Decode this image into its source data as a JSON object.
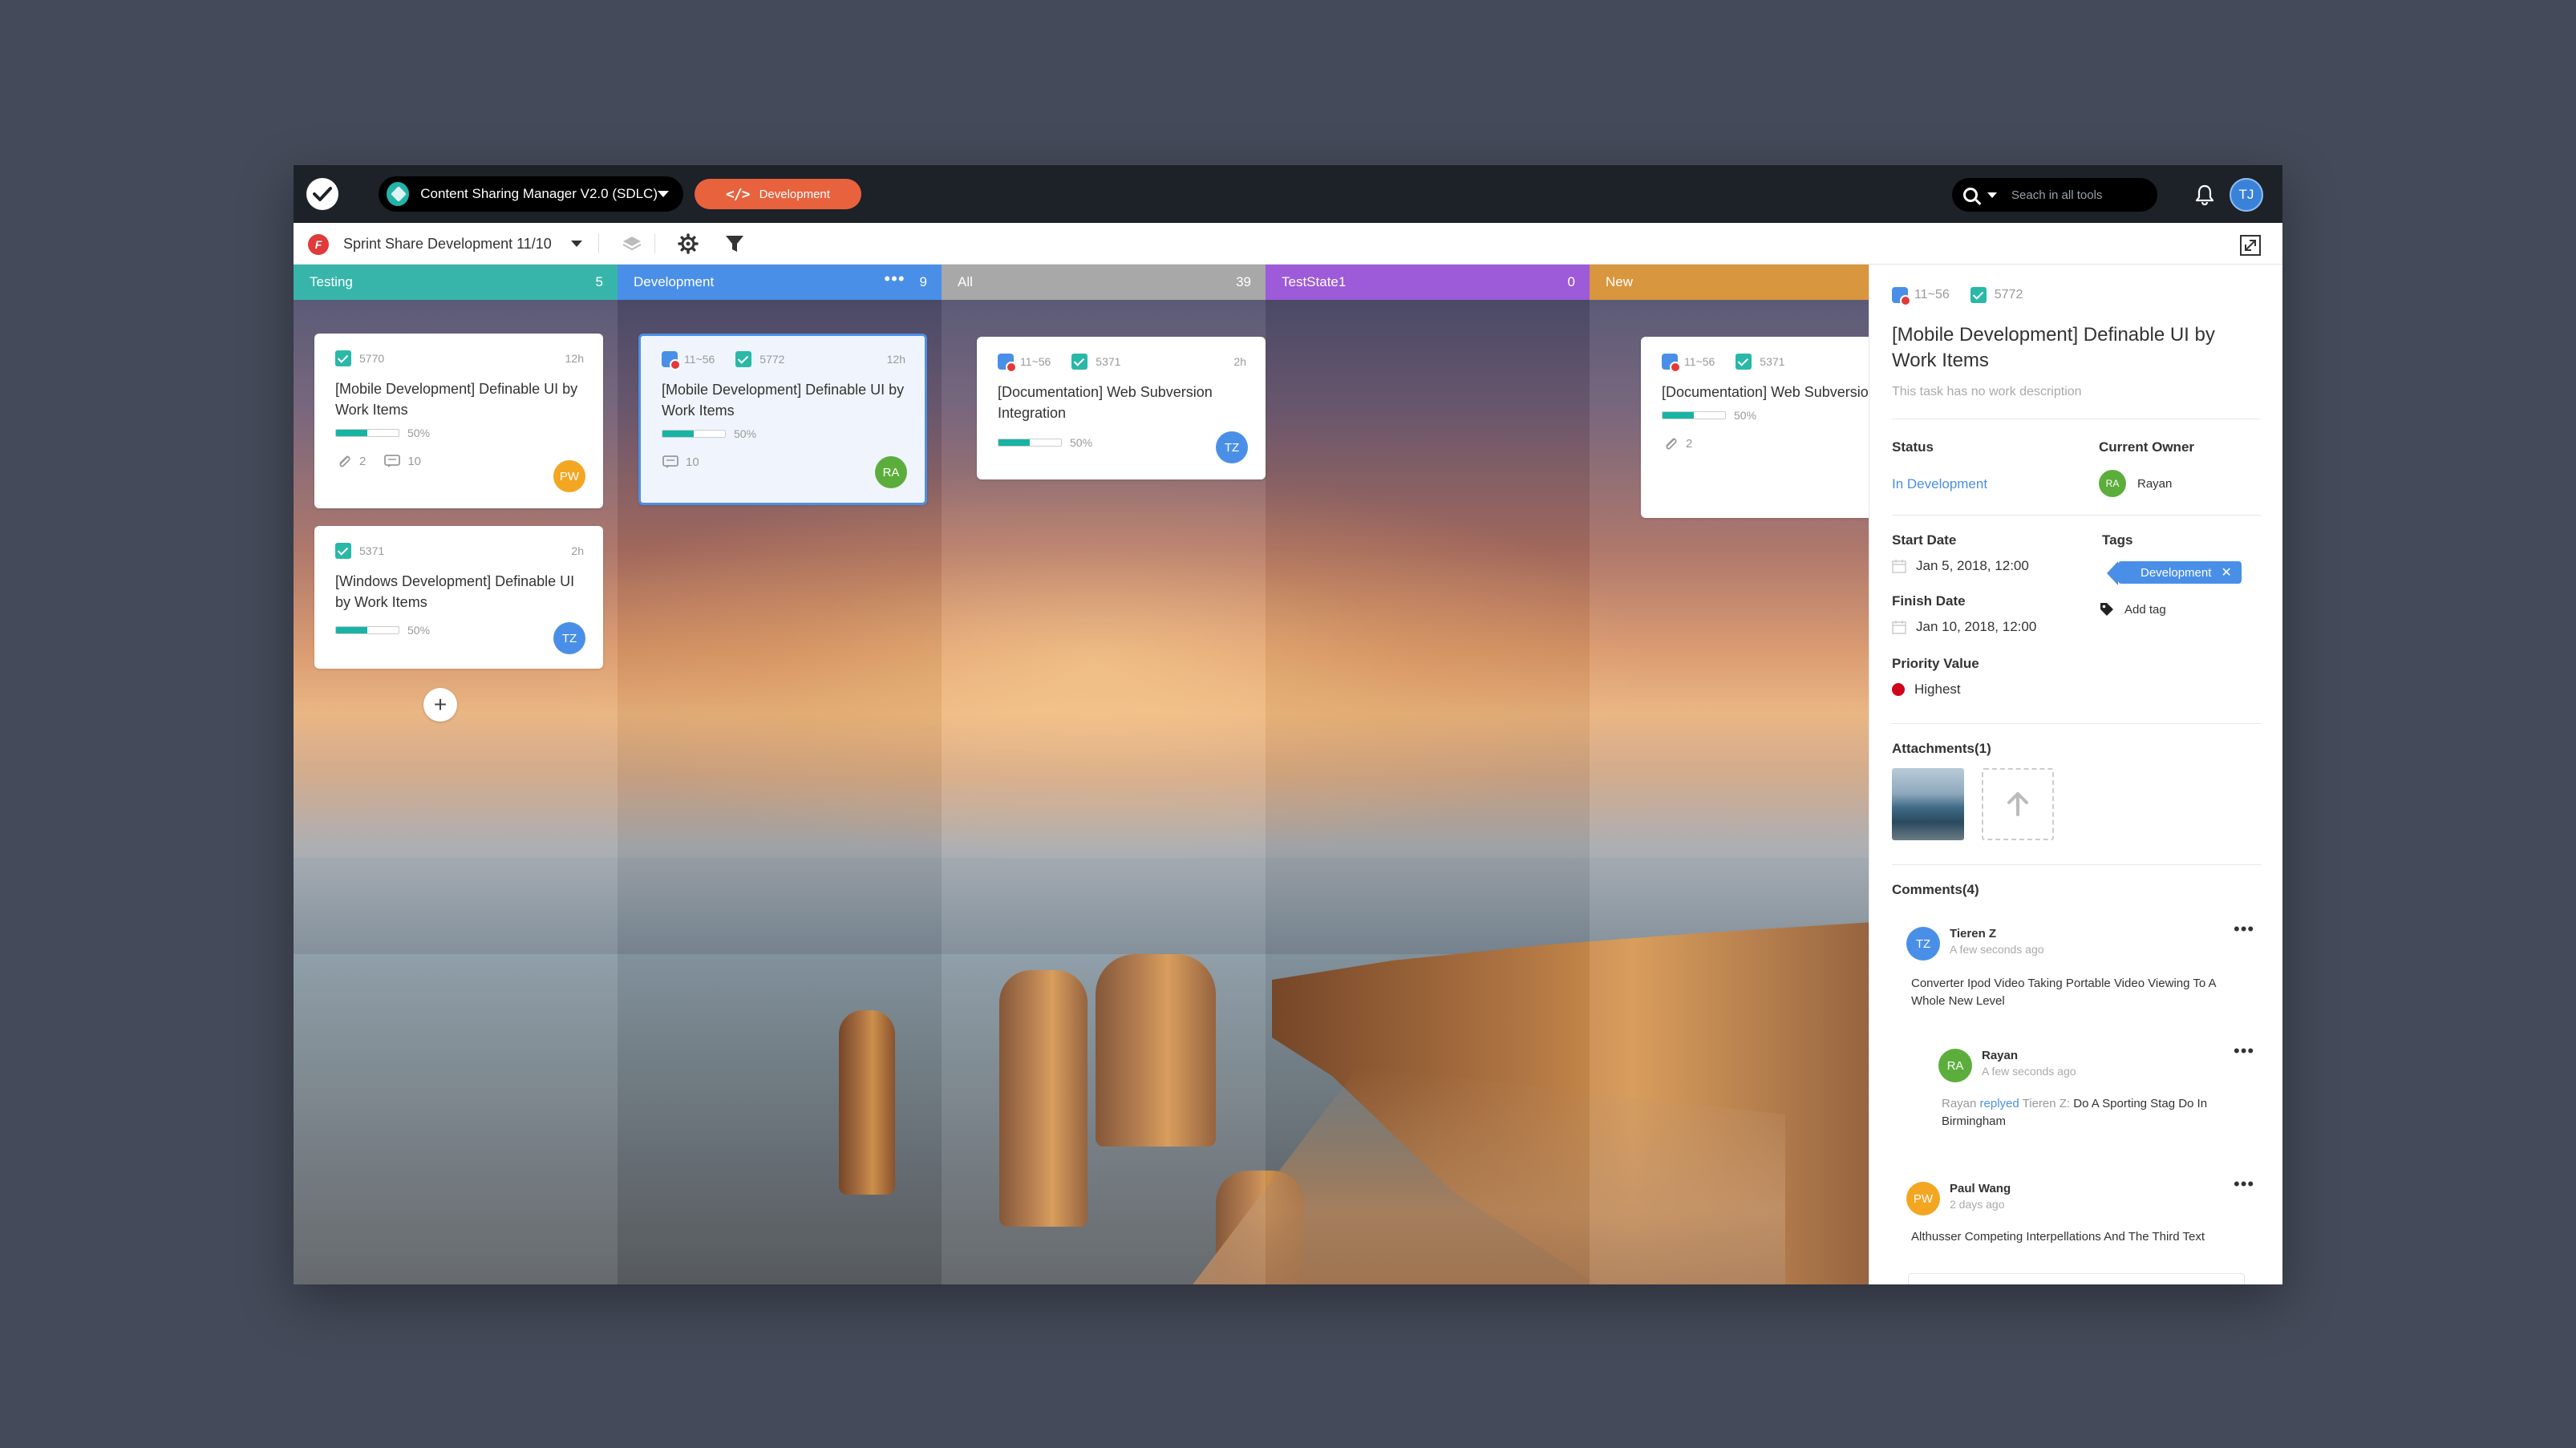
{
  "topbar": {
    "project_name": "Content Sharing Manager V2.0 (SDLC)",
    "mode_label": "Development",
    "search_placeholder": "Seach in all tools",
    "user_initials": "TJ"
  },
  "sprintbar": {
    "sprint_name": "Sprint Share Development 11/10"
  },
  "columns": [
    {
      "name": "Testing",
      "count": "5",
      "color": "#38b5ab"
    },
    {
      "name": "Development",
      "count": "9",
      "color": "#4a8fe7"
    },
    {
      "name": "All",
      "count": "39",
      "color": "#a8a8a8"
    },
    {
      "name": "TestState1",
      "count": "0",
      "color": "#9d5ad9"
    },
    {
      "name": "New",
      "count": "",
      "color": "#d8963e"
    }
  ],
  "cards": {
    "c1": {
      "id": "5770",
      "time": "12h",
      "title": "[Mobile Development] Definable UI by Work Items",
      "progress": "50%",
      "attachments": "2",
      "comments": "10",
      "avatar": "PW"
    },
    "c2": {
      "id": "5371",
      "time": "2h",
      "title": "[Windows Development] Definable UI by Work Items",
      "progress": "50%",
      "avatar": "TZ"
    },
    "c3": {
      "story": "11~56",
      "id": "5772",
      "time": "12h",
      "title": "[Mobile Development] Definable UI by Work Items",
      "progress": "50%",
      "comments": "10",
      "avatar": "RA"
    },
    "c4": {
      "story": "11~56",
      "id": "5371",
      "time": "2h",
      "title": "[Documentation] Web Subversion Integration",
      "progress": "50%",
      "avatar": "TZ"
    },
    "c5": {
      "story": "11~56",
      "id": "5371",
      "title": "[Documentation] Web Subversion Integration",
      "progress": "50%",
      "attachments": "2"
    }
  },
  "colors": {
    "accent": "#4a8fe7",
    "teal": "#2ab8a8",
    "orange": "#e8623e",
    "avatar_pw": "#f3a622",
    "avatar_tz": "#4a8fe7",
    "avatar_ra": "#5cae3c",
    "priority_high": "#d0021b"
  },
  "panel": {
    "story_id": "11~56",
    "task_id": "5772",
    "title": "[Mobile Development] Definable UI by Work Items",
    "description": "This task has no work description",
    "status_label": "Status",
    "status_value": "In Development",
    "owner_label": "Current Owner",
    "owner_initials": "RA",
    "owner_name": "Rayan",
    "start_label": "Start Date",
    "start_value": "Jan 5, 2018, 12:00",
    "tags_label": "Tags",
    "tag_value": "Development",
    "add_tag": "Add tag",
    "finish_label": "Finish Date",
    "finish_value": "Jan 10, 2018, 12:00",
    "priority_label": "Priority Value",
    "priority_value": "Highest",
    "attachments_label": "Attachments(1)",
    "comments_label": "Comments(4)",
    "comments": [
      {
        "initials": "TZ",
        "name": "Tieren Z",
        "time": "A few seconds ago",
        "text": "Converter Ipod Video Taking Portable Video Viewing To A Whole New Level"
      },
      {
        "initials": "RA",
        "name": "Rayan",
        "time": "A few seconds ago",
        "reply_from": "Rayan",
        "reply_word": "replyed",
        "reply_to": "Tieren Z:",
        "text": "Do A Sporting Stag Do In Birmingham"
      },
      {
        "initials": "PW",
        "name": "Paul Wang",
        "time": "2 days ago",
        "text": "Althusser Competing Interpellations And The Third Text"
      }
    ]
  }
}
